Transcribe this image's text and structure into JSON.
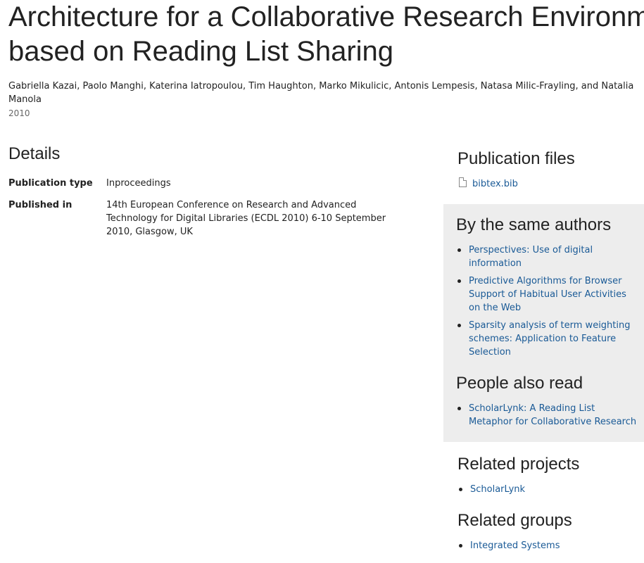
{
  "publication": {
    "title_line1": "Architecture for a Collaborative Research Environment",
    "title_line2": "based on Reading List Sharing",
    "authors": "Gabriella Kazai, Paolo Manghi, Katerina Iatropoulou, Tim Haughton, Marko Mikulicic, Antonis Lempesis, Natasa Milic-Frayling, and Natalia Manola",
    "year": "2010"
  },
  "details": {
    "heading": "Details",
    "rows": [
      {
        "label": "Publication type",
        "value": "Inproceedings"
      },
      {
        "label": "Published in",
        "value": "14th European Conference on Research and Advanced Technology for Digital Libraries (ECDL 2010) 6-10 September 2010, Glasgow, UK"
      }
    ]
  },
  "sidebar": {
    "files": {
      "heading": "Publication files",
      "items": [
        {
          "label": "bibtex.bib",
          "icon": "file-icon"
        }
      ]
    },
    "same_authors": {
      "heading": "By the same authors",
      "items": [
        {
          "label": "Perspectives: Use of digital information"
        },
        {
          "label": "Predictive Algorithms for Browser Support of Habitual User Activities on the Web"
        },
        {
          "label": "Sparsity analysis of term weighting schemes: Application to Feature Selection"
        }
      ]
    },
    "also_read": {
      "heading": "People also read",
      "items": [
        {
          "label": "ScholarLynk: A Reading List Metaphor for Collaborative Research"
        }
      ]
    },
    "projects": {
      "heading": "Related projects",
      "items": [
        {
          "label": "ScholarLynk"
        }
      ]
    },
    "groups": {
      "heading": "Related groups",
      "items": [
        {
          "label": "Integrated Systems"
        }
      ]
    }
  },
  "colors": {
    "link": "#1a5a96",
    "sidebar_box_background": "#ededed",
    "text": "#222222"
  }
}
